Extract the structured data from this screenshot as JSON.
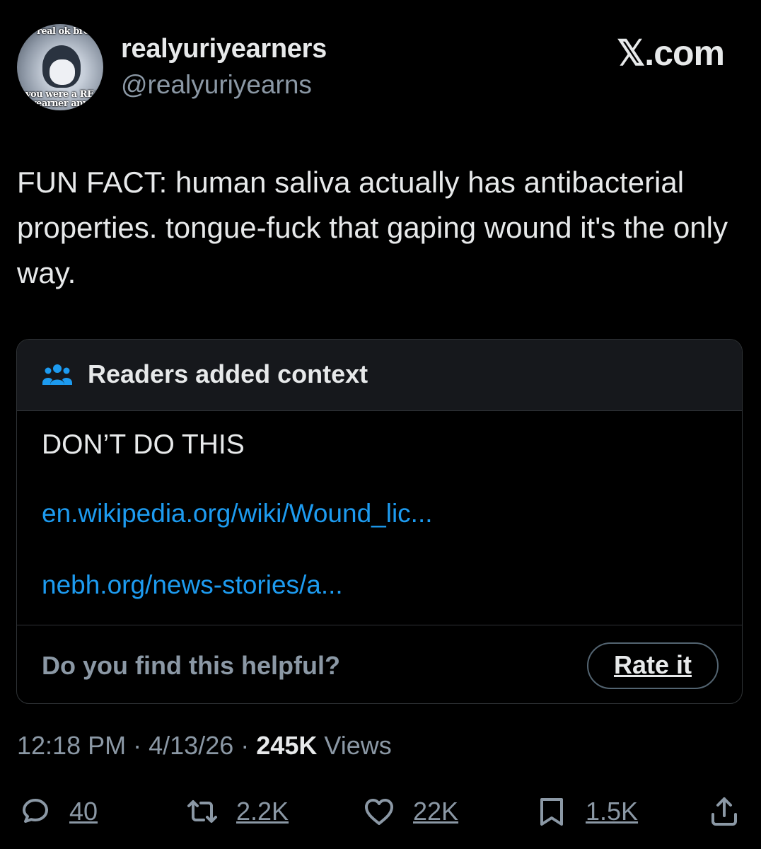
{
  "author": {
    "name": "realyuriyearners",
    "handle": "@realyuriyearns",
    "avatar_caption_top": "real ok bro",
    "avatar_caption_mid": "you were a REAL yuri",
    "avatar_caption_bot": "yearner anyway"
  },
  "site": "𝕏.com",
  "post": {
    "text": "FUN FACT: human saliva actually has antibacterial properties. tongue-fuck that gaping wound it's the only way."
  },
  "community_note": {
    "title": "Readers added context",
    "text": "DON’T DO THIS",
    "links": [
      "en.wikipedia.org/wiki/Wound_lic...",
      "nebh.org/news-stories/a..."
    ],
    "helpful_prompt": "Do you find this helpful?",
    "rate_label": "Rate it"
  },
  "meta": {
    "time": "12:18 PM",
    "separator": "·",
    "date": "4/13/26",
    "views_count": "245K",
    "views_label": "Views"
  },
  "actions": {
    "replies": "40",
    "reposts": "2.2K",
    "likes": "22K",
    "bookmarks": "1.5K"
  },
  "icons": {
    "reply": "reply-icon",
    "repost": "repost-icon",
    "like": "heart-icon",
    "bookmark": "bookmark-icon",
    "share": "share-icon",
    "note": "people-icon"
  },
  "colors": {
    "background": "#000000",
    "text": "#e7e9ea",
    "secondary": "#8b98a5",
    "link": "#1d9bf0",
    "note_header_bg": "#16181c",
    "border": "#2f3336"
  }
}
